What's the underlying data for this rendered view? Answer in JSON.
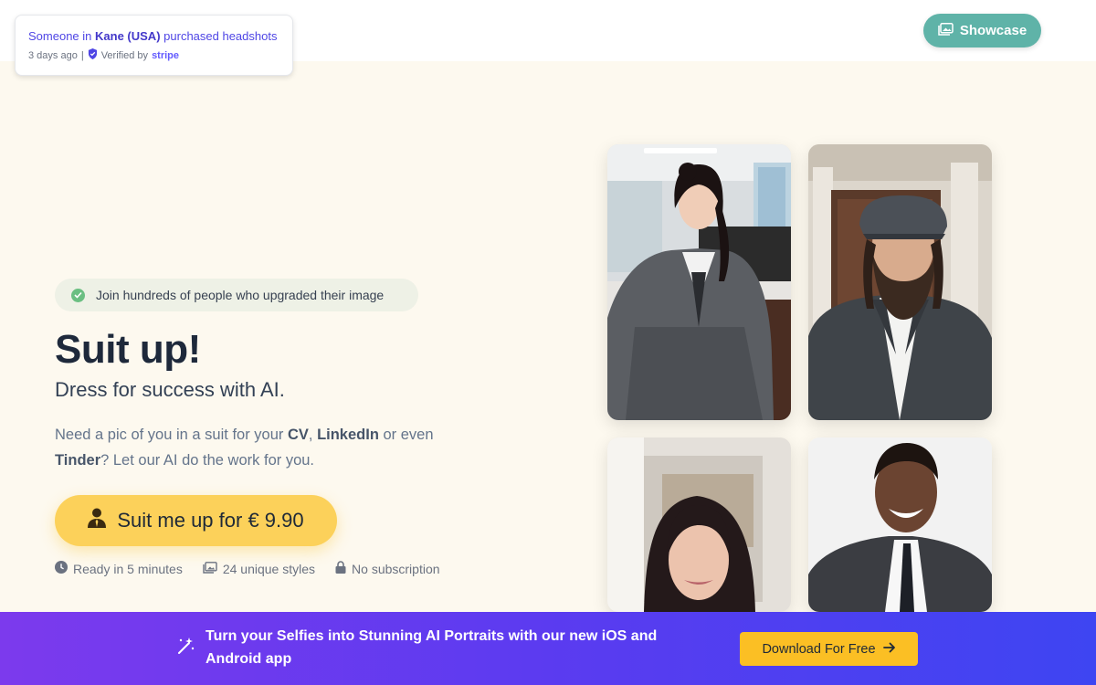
{
  "notification": {
    "prefix": "Someone in",
    "location": "Kane (USA)",
    "suffix": "purchased headshots",
    "time": "3 days ago",
    "separator": "|",
    "verified_label": "Verified by",
    "verified_brand": "stripe"
  },
  "header": {
    "showcase_label": "Showcase"
  },
  "hero": {
    "badge_text": "Join hundreds of people who upgraded their image",
    "title": "Suit up!",
    "subtitle": "Dress for success with AI.",
    "desc_1": "Need a pic of you in a suit for your ",
    "desc_cv": "CV",
    "desc_2": ", ",
    "desc_linkedin": "LinkedIn",
    "desc_3": " or even ",
    "desc_tinder": "Tinder",
    "desc_4": "? Let our AI do the work for you.",
    "cta_label": "Suit me up for € 9.90",
    "features": [
      {
        "icon": "clock-icon",
        "label": "Ready in 5 minutes"
      },
      {
        "icon": "images-icon",
        "label": "24 unique styles"
      },
      {
        "icon": "lock-icon",
        "label": "No subscription"
      }
    ]
  },
  "banner": {
    "text": "Turn your Selfies into Stunning AI Portraits with our new iOS and Android app",
    "button_label": "Download For Free",
    "icon": "magic-wand-icon",
    "button_icon": "arrow-right-icon"
  },
  "colors": {
    "accent_teal": "#5fb3a8",
    "cta_yellow": "#fcd15a",
    "banner_purple": "#7c3aed",
    "banner_blue": "#3e45f2"
  }
}
